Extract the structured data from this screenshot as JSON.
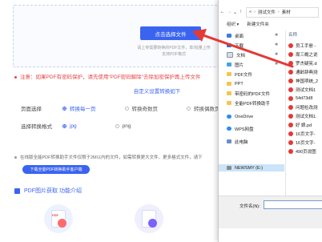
{
  "upload": {
    "button_label": "点击选择文件",
    "hint_line1": "请上传需要转换的PDF文件，单/批量上传",
    "hint_line2": "支持PDF格式"
  },
  "notice": "注意：如果PDF有密码保护，请先使用“PDF密码解除”去除加密保护再上传文件",
  "settings": {
    "title": "自定义设置转换如下",
    "pages_label": "页面选择",
    "pages_options": [
      "转换每一页",
      "转换奇数页",
      "转换偶数页"
    ],
    "pages_selected": 0,
    "format_label": "选择转换格式",
    "format_options": [
      "jpg",
      "png"
    ],
    "format_selected": 0
  },
  "promo": {
    "text": "在线版全能PDF转换助手文件仅限于2M以内的文件，如需转换更大文件、更多格式文件，请下",
    "button_label": "下载全能PDF转换助手客户端"
  },
  "intro": {
    "title": "PDF图片获取 功能介绍",
    "feature_icons": [
      "pdf-document-icon",
      "image-edit-icon",
      "cloud-upload-icon"
    ],
    "pdf_tag": "PDF"
  },
  "dialog": {
    "nav_back": "←",
    "nav_forward": "→",
    "nav_dropdown": "⌄",
    "nav_up": "↑",
    "address_parts": [
      "«",
      "测试文件",
      "素材"
    ],
    "address_sep": "›",
    "toolbar_organize": "组织 ▾",
    "toolbar_new_folder": "新建文件夹",
    "tree": [
      {
        "label": "桌面",
        "icon": "desktop-icon",
        "pinned": true
      },
      {
        "label": "下载",
        "icon": "download-icon",
        "pinned": true
      },
      {
        "label": "文档",
        "icon": "document-icon",
        "pinned": true
      },
      {
        "label": "图片",
        "icon": "pictures-icon",
        "pinned": true
      },
      {
        "label": "PDF文件",
        "icon": "folder-icon",
        "pinned": false
      },
      {
        "label": "PPT",
        "icon": "folder-icon",
        "pinned": false
      },
      {
        "label": "带密码的PDF文件",
        "icon": "folder-icon",
        "pinned": false
      },
      {
        "label": "全能PDF转换助手",
        "icon": "folder-icon",
        "pinned": false
      },
      {
        "label": "OneDrive",
        "icon": "onedrive-icon",
        "pinned": false
      },
      {
        "label": "WPS网盘",
        "icon": "wps-cloud-icon",
        "pinned": false
      },
      {
        "label": "此电脑",
        "icon": "this-pc-icon",
        "pinned": false
      },
      {
        "label": "NEWSMY (E:)",
        "icon": "drive-icon",
        "pinned": false
      }
    ],
    "pin_glyph": "✱",
    "column_name": "名称",
    "files": [
      "员工手册 -",
      "周三概之说",
      "罗杰疑宪.d",
      "通龄辞典测",
      "神国项统_2",
      "测试文档1",
      "54d73d8",
      "问题检改测",
      "测试文档1.",
      "好   娘.pd",
      "16页文字-",
      "16页文字-",
      "490页说图"
    ],
    "filename_label": "文件名(N):"
  }
}
